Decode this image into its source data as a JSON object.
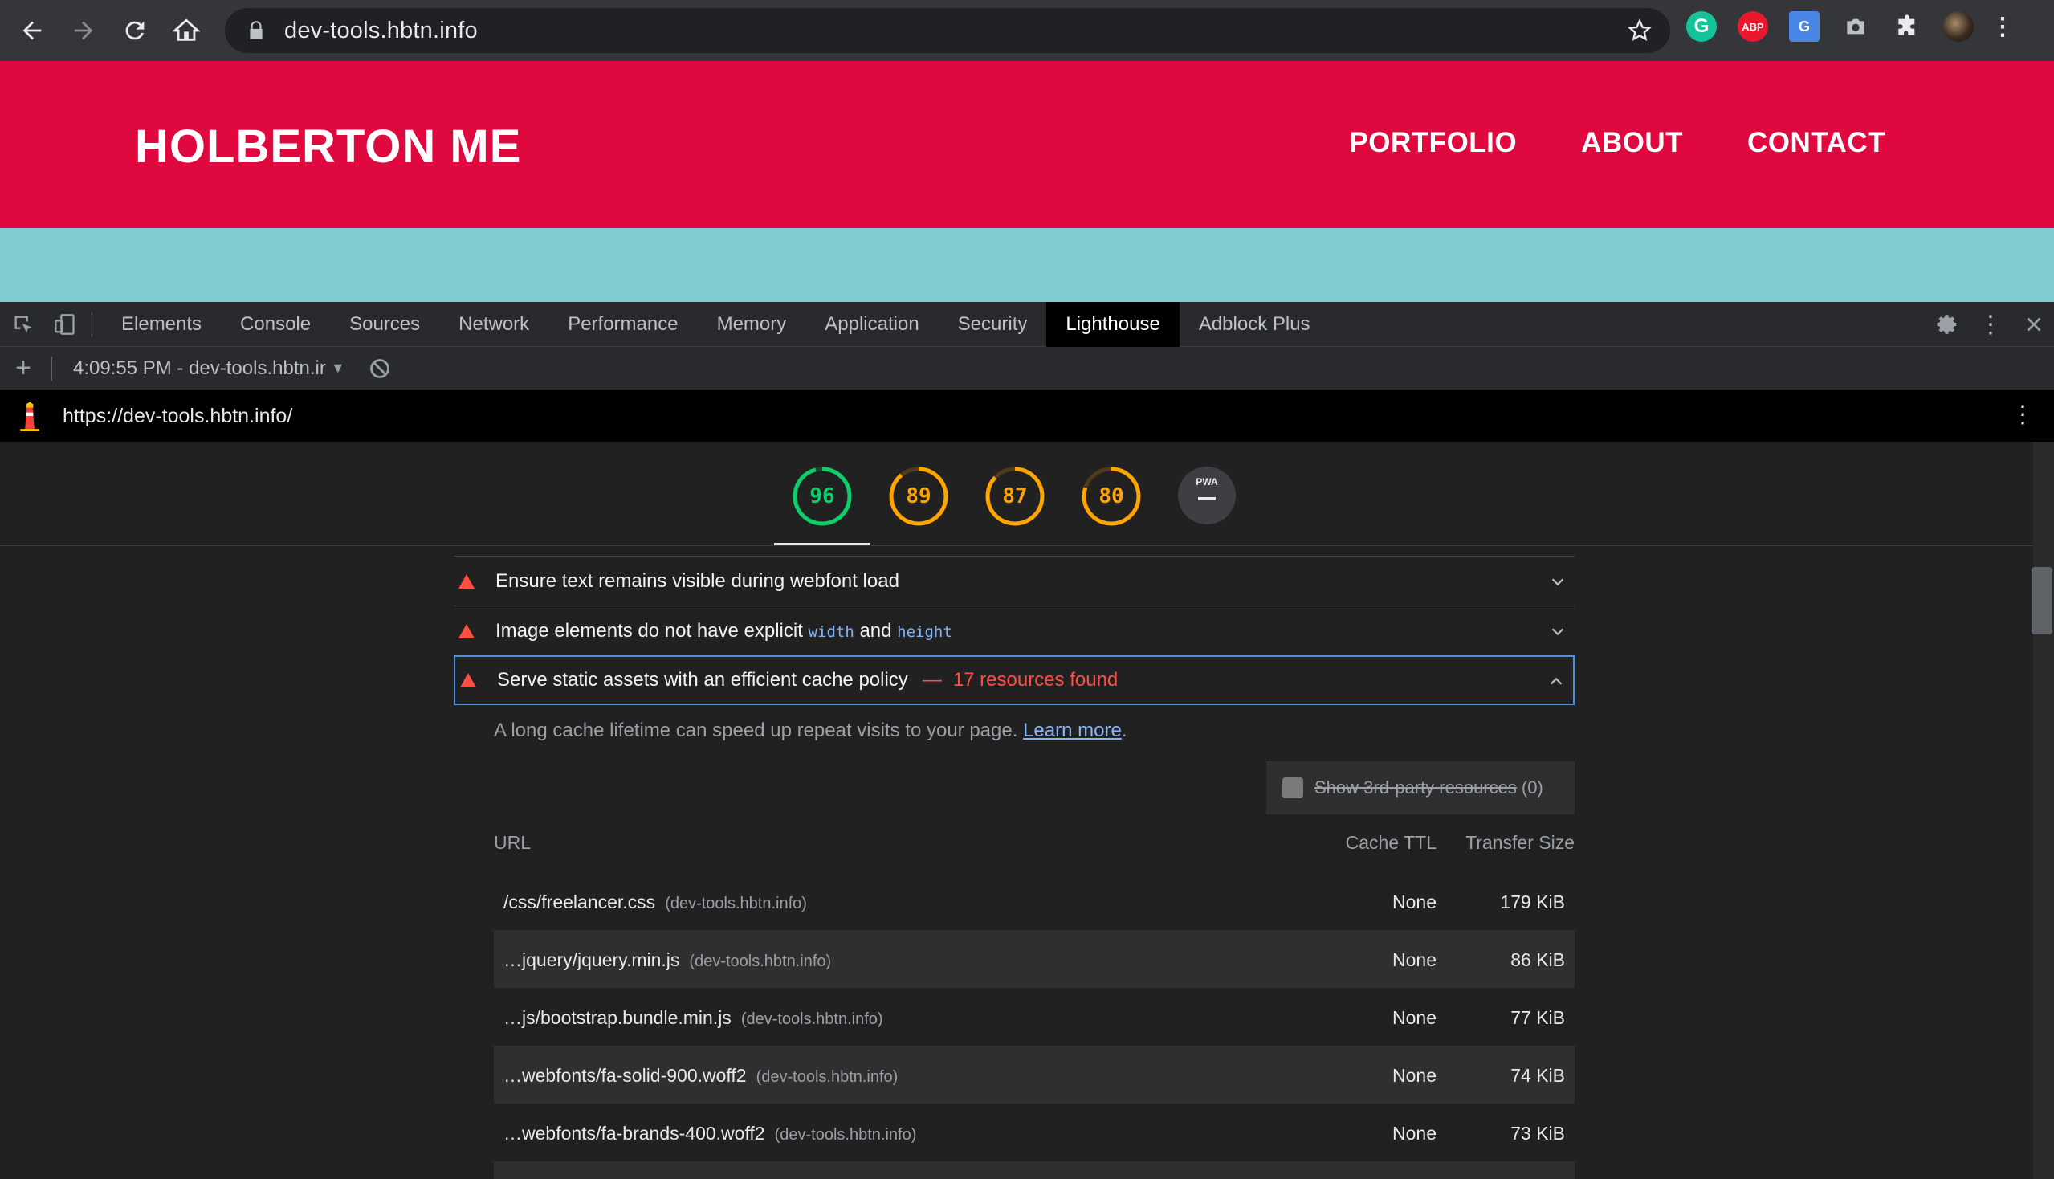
{
  "browser": {
    "address": "dev-tools.hbtn.info"
  },
  "site": {
    "title": "HOLBERTON ME",
    "nav": [
      "PORTFOLIO",
      "ABOUT",
      "CONTACT"
    ]
  },
  "devtools": {
    "tabs": [
      "Elements",
      "Console",
      "Sources",
      "Network",
      "Performance",
      "Memory",
      "Application",
      "Security",
      "Lighthouse",
      "Adblock Plus"
    ],
    "active_tab": "Lighthouse",
    "report_label": "4:09:55 PM - dev-tools.hbtn.ir"
  },
  "lighthouse": {
    "url": "https://dev-tools.hbtn.info/",
    "scores": [
      {
        "value": "96",
        "color": "#0cce6b",
        "fraction": 0.96
      },
      {
        "value": "89",
        "color": "#ffa400",
        "fraction": 0.89
      },
      {
        "value": "87",
        "color": "#ffa400",
        "fraction": 0.87
      },
      {
        "value": "80",
        "color": "#ffa400",
        "fraction": 0.8
      }
    ],
    "pwa_label": "PWA",
    "audits": [
      {
        "title": "Ensure text remains visible during webfont load"
      },
      {
        "title_prefix": "Image elements do not have explicit",
        "code1": "width",
        "joiner": "and",
        "code2": "height"
      },
      {
        "title": "Serve static assets with an efficient cache policy",
        "separator": "—",
        "display": "17 resources found"
      }
    ],
    "description": "A long cache lifetime can speed up repeat visits to your page.",
    "learn_more": "Learn more",
    "third_party_label": "Show 3rd-party resources",
    "third_party_count": "(0)",
    "table": {
      "headers": {
        "url": "URL",
        "ttl": "Cache TTL",
        "size": "Transfer Size"
      },
      "rows": [
        {
          "url": "/css/freelancer.css",
          "host": "(dev-tools.hbtn.info)",
          "ttl": "None",
          "size": "179 KiB"
        },
        {
          "url": "…jquery/jquery.min.js",
          "host": "(dev-tools.hbtn.info)",
          "ttl": "None",
          "size": "86 KiB"
        },
        {
          "url": "…js/bootstrap.bundle.min.js",
          "host": "(dev-tools.hbtn.info)",
          "ttl": "None",
          "size": "77 KiB"
        },
        {
          "url": "…webfonts/fa-solid-900.woff2",
          "host": "(dev-tools.hbtn.info)",
          "ttl": "None",
          "size": "74 KiB"
        },
        {
          "url": "…webfonts/fa-brands-400.woff2",
          "host": "(dev-tools.hbtn.info)",
          "ttl": "None",
          "size": "73 KiB"
        }
      ]
    }
  }
}
